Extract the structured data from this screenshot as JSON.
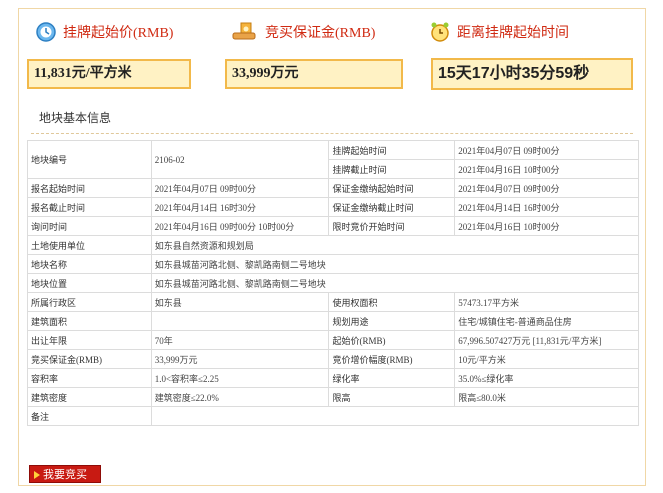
{
  "header": {
    "start_price_label": "挂牌起始价(RMB)",
    "deposit_label": "竞买保证金(RMB)",
    "countdown_label": "距离挂牌起始时间",
    "start_price_value": "11,831元/平方米",
    "deposit_value": "33,999万元",
    "countdown_value": "15天17小时35分59秒"
  },
  "section_title": "地块基本信息",
  "table": {
    "r1": {
      "l1": "地块编号",
      "v1": "2106-02",
      "l2a": "挂牌起始时间",
      "v2a": "2021年04月07日 09时00分",
      "l2b": "挂牌截止时间",
      "v2b": "2021年04月16日 10时00分"
    },
    "r2": {
      "l1": "报名起始时间",
      "v1": "2021年04月07日 09时00分",
      "l2": "保证金缴纳起始时间",
      "v2": "2021年04月07日 09时00分"
    },
    "r3": {
      "l1": "报名截止时间",
      "v1": "2021年04月14日 16时30分",
      "l2": "保证金缴纳截止时间",
      "v2": "2021年04月14日 16时00分"
    },
    "r4": {
      "l1": "询问时间",
      "v1": "2021年04月16日 09时00分 10时00分",
      "l2": "限时竞价开始时间",
      "v2": "2021年04月16日 10时00分"
    },
    "r5": {
      "l1": "土地使用单位",
      "v1": "如东县自然资源和规划局"
    },
    "r6": {
      "l1": "地块名称",
      "v1": "如东县城苗河路北侧、黎凯路南侧二号地块"
    },
    "r7": {
      "l1": "地块位置",
      "v1": "如东县城苗河路北侧、黎凯路南侧二号地块"
    },
    "r8": {
      "l1": "所属行政区",
      "v1": "如东县",
      "l2": "使用权面积",
      "v2": "57473.17平方米"
    },
    "r9": {
      "l1": "建筑面积",
      "v1": "",
      "l2": "规划用途",
      "v2": "住宅/城镇住宅-普通商品住房"
    },
    "r10": {
      "l1": "出让年限",
      "v1": "70年",
      "l2": "起始价(RMB)",
      "v2": "67,996.507427万元 [11,831元/平方米]"
    },
    "r11": {
      "l1": "竞买保证金(RMB)",
      "v1": "33,999万元",
      "l2": "竞价增价幅度(RMB)",
      "v2": "10元/平方米"
    },
    "r12": {
      "l1": "容积率",
      "v1": "1.0<容积率≤2.25",
      "l2": "绿化率",
      "v2": "35.0%≤绿化率"
    },
    "r13": {
      "l1": "建筑密度",
      "v1": "建筑密度≤22.0%",
      "l2": "限高",
      "v2": "限高≤80.0米"
    },
    "r14": {
      "l1": "备注",
      "v1": ""
    }
  },
  "bid_button": "我要竞买",
  "colors": {
    "accent": "#d02a12",
    "box_bg": "#fff2c4",
    "box_border": "#f2b94a"
  }
}
